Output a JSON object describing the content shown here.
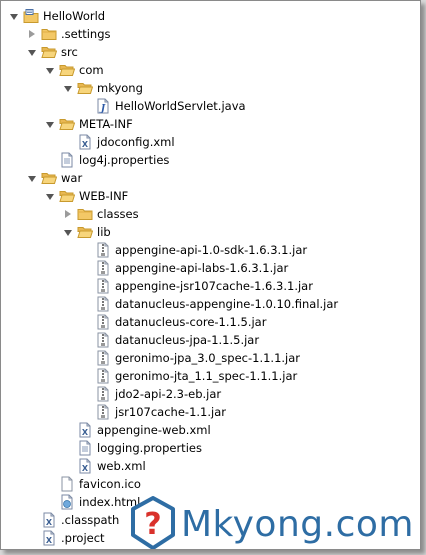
{
  "tree": [
    {
      "label": "HelloWorld",
      "depth": 0,
      "toggle": "open",
      "icon": "project-icon"
    },
    {
      "label": ".settings",
      "depth": 1,
      "toggle": "closed",
      "icon": "folder-icon"
    },
    {
      "label": "src",
      "depth": 1,
      "toggle": "open",
      "icon": "folder-open-icon"
    },
    {
      "label": "com",
      "depth": 2,
      "toggle": "open",
      "icon": "folder-open-icon"
    },
    {
      "label": "mkyong",
      "depth": 3,
      "toggle": "open",
      "icon": "folder-open-icon"
    },
    {
      "label": "HelloWorldServlet.java",
      "depth": 4,
      "toggle": "none",
      "icon": "java-file-icon"
    },
    {
      "label": "META-INF",
      "depth": 2,
      "toggle": "open",
      "icon": "folder-open-icon"
    },
    {
      "label": "jdoconfig.xml",
      "depth": 3,
      "toggle": "none",
      "icon": "xml-file-icon"
    },
    {
      "label": "log4j.properties",
      "depth": 2,
      "toggle": "none",
      "icon": "properties-file-icon"
    },
    {
      "label": "war",
      "depth": 1,
      "toggle": "open",
      "icon": "folder-open-icon"
    },
    {
      "label": "WEB-INF",
      "depth": 2,
      "toggle": "open",
      "icon": "folder-open-icon"
    },
    {
      "label": "classes",
      "depth": 3,
      "toggle": "closed",
      "icon": "folder-icon"
    },
    {
      "label": "lib",
      "depth": 3,
      "toggle": "open",
      "icon": "folder-open-icon"
    },
    {
      "label": "appengine-api-1.0-sdk-1.6.3.1.jar",
      "depth": 4,
      "toggle": "none",
      "icon": "jar-file-icon"
    },
    {
      "label": "appengine-api-labs-1.6.3.1.jar",
      "depth": 4,
      "toggle": "none",
      "icon": "jar-file-icon"
    },
    {
      "label": "appengine-jsr107cache-1.6.3.1.jar",
      "depth": 4,
      "toggle": "none",
      "icon": "jar-file-icon"
    },
    {
      "label": "datanucleus-appengine-1.0.10.final.jar",
      "depth": 4,
      "toggle": "none",
      "icon": "jar-file-icon"
    },
    {
      "label": "datanucleus-core-1.1.5.jar",
      "depth": 4,
      "toggle": "none",
      "icon": "jar-file-icon"
    },
    {
      "label": "datanucleus-jpa-1.1.5.jar",
      "depth": 4,
      "toggle": "none",
      "icon": "jar-file-icon"
    },
    {
      "label": "geronimo-jpa_3.0_spec-1.1.1.jar",
      "depth": 4,
      "toggle": "none",
      "icon": "jar-file-icon"
    },
    {
      "label": "geronimo-jta_1.1_spec-1.1.1.jar",
      "depth": 4,
      "toggle": "none",
      "icon": "jar-file-icon"
    },
    {
      "label": "jdo2-api-2.3-eb.jar",
      "depth": 4,
      "toggle": "none",
      "icon": "jar-file-icon"
    },
    {
      "label": "jsr107cache-1.1.jar",
      "depth": 4,
      "toggle": "none",
      "icon": "jar-file-icon"
    },
    {
      "label": "appengine-web.xml",
      "depth": 3,
      "toggle": "none",
      "icon": "xml-file-icon"
    },
    {
      "label": "logging.properties",
      "depth": 3,
      "toggle": "none",
      "icon": "properties-file-icon"
    },
    {
      "label": "web.xml",
      "depth": 3,
      "toggle": "none",
      "icon": "xml-file-icon"
    },
    {
      "label": "favicon.ico",
      "depth": 2,
      "toggle": "none",
      "icon": "generic-file-icon"
    },
    {
      "label": "index.html",
      "depth": 2,
      "toggle": "none",
      "icon": "html-file-icon"
    },
    {
      "label": ".classpath",
      "depth": 1,
      "toggle": "none",
      "icon": "xml-file-icon"
    },
    {
      "label": ".project",
      "depth": 1,
      "toggle": "none",
      "icon": "xml-file-icon"
    }
  ],
  "watermark": {
    "text": "Mkyong.com"
  },
  "colors": {
    "folder": "#f3c866",
    "folder_border": "#c89a2e",
    "watermark_blue": "#2e6da4",
    "watermark_red": "#d9312b"
  }
}
